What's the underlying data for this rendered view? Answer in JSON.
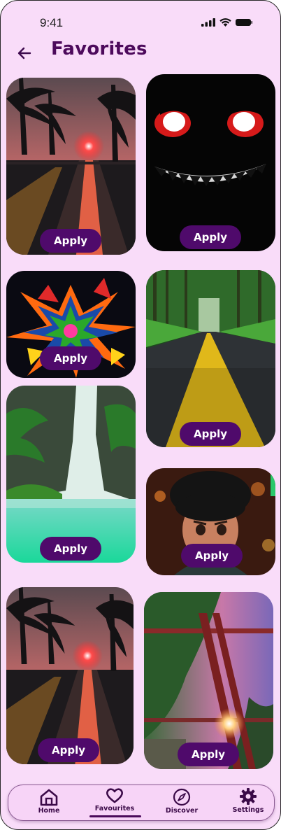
{
  "status_bar": {
    "time": "9:41"
  },
  "header": {
    "title": "Favorites"
  },
  "wallpapers": [
    {
      "name": "sunset-palm-road",
      "apply_label": "Apply"
    },
    {
      "name": "grinning-shadow-monster",
      "apply_label": "Apply"
    },
    {
      "name": "color-paint-splash",
      "apply_label": "Apply"
    },
    {
      "name": "forest-road-yellow-line",
      "apply_label": "Apply"
    },
    {
      "name": "jungle-cliffs-lagoon",
      "apply_label": "Apply"
    },
    {
      "name": "cartoon-boy-character",
      "apply_label": "Apply"
    },
    {
      "name": "sunset-palm-road",
      "apply_label": "Apply"
    },
    {
      "name": "torii-gate-sunset",
      "apply_label": "Apply"
    }
  ],
  "bottom_nav": {
    "items": [
      {
        "label": "Home",
        "icon": "home-icon"
      },
      {
        "label": "Favourites",
        "icon": "heart-icon",
        "active": true
      },
      {
        "label": "Discover",
        "icon": "compass-icon"
      },
      {
        "label": "Settings",
        "icon": "gear-icon"
      }
    ]
  },
  "colors": {
    "background": "#f9dcf9",
    "accent": "#4f0a6b",
    "title": "#4d0a5c"
  }
}
